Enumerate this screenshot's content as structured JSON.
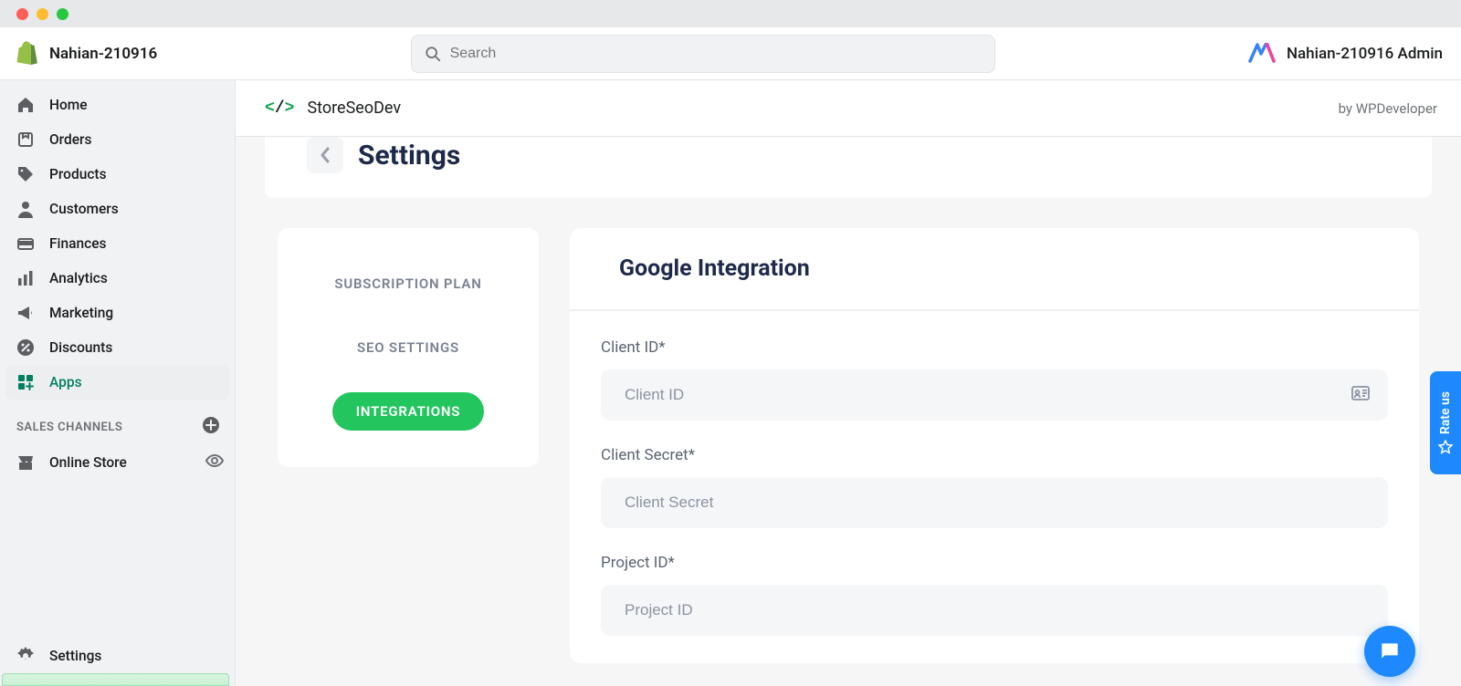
{
  "store_name": "Nahian-210916",
  "search_placeholder": "Search",
  "account_name": "Nahian-210916 Admin",
  "sidebar": {
    "items": [
      {
        "label": "Home",
        "icon": "home"
      },
      {
        "label": "Orders",
        "icon": "orders"
      },
      {
        "label": "Products",
        "icon": "products"
      },
      {
        "label": "Customers",
        "icon": "customers"
      },
      {
        "label": "Finances",
        "icon": "finances"
      },
      {
        "label": "Analytics",
        "icon": "analytics"
      },
      {
        "label": "Marketing",
        "icon": "marketing"
      },
      {
        "label": "Discounts",
        "icon": "discounts"
      },
      {
        "label": "Apps",
        "icon": "apps"
      }
    ],
    "section_label": "SALES CHANNELS",
    "channels": [
      {
        "label": "Online Store"
      }
    ],
    "settings_label": "Settings"
  },
  "app": {
    "title": "StoreSeoDev",
    "by": "by WPDeveloper"
  },
  "page": {
    "title": "Settings",
    "nav": [
      "SUBSCRIPTION PLAN",
      "SEO SETTINGS",
      "INTEGRATIONS"
    ],
    "nav_active_index": 2
  },
  "form": {
    "title": "Google Integration",
    "fields": [
      {
        "label": "Client ID*",
        "placeholder": "Client ID",
        "hasIcon": true
      },
      {
        "label": "Client Secret*",
        "placeholder": "Client Secret",
        "hasIcon": false
      },
      {
        "label": "Project ID*",
        "placeholder": "Project ID",
        "hasIcon": false
      }
    ]
  },
  "rate_us": "Rate us"
}
